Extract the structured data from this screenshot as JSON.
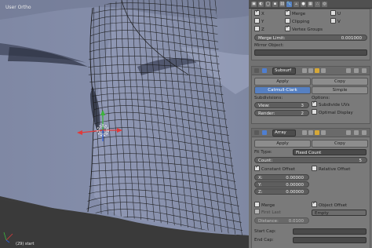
{
  "viewport": {
    "label": "User Ortho",
    "status": "(29) start"
  },
  "mirror": {
    "axes": [
      {
        "label": "X",
        "checked": true
      },
      {
        "label": "Y",
        "checked": false
      },
      {
        "label": "Z",
        "checked": false
      }
    ],
    "merge_label": "Merge",
    "merge_checked": true,
    "clipping_label": "Clipping",
    "clipping_checked": false,
    "vertex_groups_label": "Vertex Groups",
    "vertex_groups_checked": true,
    "u_label": "U",
    "v_label": "V",
    "merge_limit_label": "Merge Limit:",
    "merge_limit_value": "0.001000",
    "mirror_object_label": "Mirror Object:"
  },
  "subsurf": {
    "name": "Subsurf",
    "apply_label": "Apply",
    "copy_label": "Copy",
    "tab_catmull": "Catmull-Clark",
    "tab_simple": "Simple",
    "subdivisions_label": "Subdivisions:",
    "view_label": "View:",
    "view_value": "3",
    "render_label": "Render:",
    "render_value": "2",
    "options_label": "Options:",
    "subdivide_uvs_label": "Subdivide UVs",
    "optimal_display_label": "Optimal Display"
  },
  "array": {
    "name": "Array",
    "apply_label": "Apply",
    "copy_label": "Copy",
    "fit_type_label": "Fit Type:",
    "fit_type_value": "Fixed Count",
    "count_label": "Count:",
    "count_value": "5",
    "constant_offset_label": "Constant Offset",
    "relative_offset_label": "Relative Offset",
    "x_label": "X:",
    "x_value": "0.00000",
    "y_label": "Y:",
    "y_value": "0.00000",
    "z_label": "Z:",
    "z_value": "0.00000",
    "merge_label": "Merge",
    "object_offset_label": "Object Offset",
    "first_last_label": "First Last",
    "empty_value": "Empty",
    "distance_label": "Distance:",
    "distance_value": "0.0100",
    "start_cap_label": "Start Cap:",
    "end_cap_label": "End Cap:"
  },
  "colors": {
    "accent": "#5680c2",
    "mesh": "#8a93ae",
    "panel": "#727272"
  }
}
